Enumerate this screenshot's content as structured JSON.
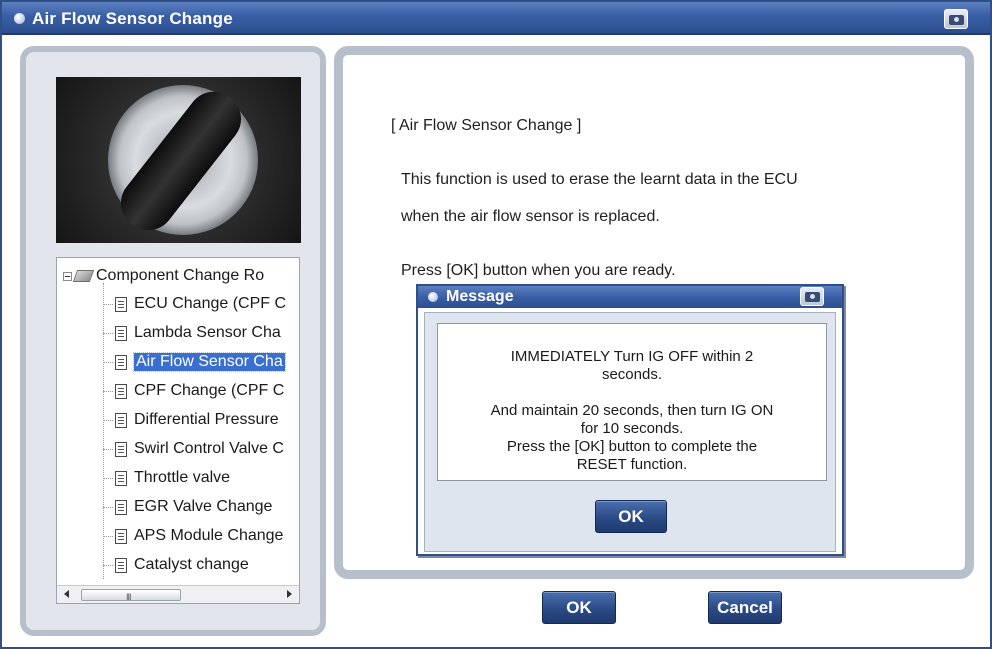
{
  "window": {
    "title": "Air Flow Sensor Change"
  },
  "tree": {
    "root_label": "Component Change Ro",
    "items": [
      {
        "label": "ECU Change (CPF C"
      },
      {
        "label": "Lambda Sensor Cha"
      },
      {
        "label": "Air Flow Sensor Cha",
        "selected": true
      },
      {
        "label": "CPF Change (CPF C"
      },
      {
        "label": "Differential Pressure"
      },
      {
        "label": "Swirl Control Valve C"
      },
      {
        "label": "Throttle valve"
      },
      {
        "label": "EGR Valve Change"
      },
      {
        "label": "APS Module Change"
      },
      {
        "label": "Catalyst change"
      }
    ],
    "scroll_grip": "III"
  },
  "main": {
    "heading": "[ Air Flow Sensor Change ]",
    "description_line1": "This function is used to erase the learnt data in the ECU",
    "description_line2": "when the air flow sensor is replaced.",
    "instruction": "Press [OK] button when you are ready."
  },
  "message": {
    "title": "Message",
    "lines": [
      "IMMEDIATELY Turn IG OFF within 2",
      "seconds.",
      "And maintain 20 seconds, then turn IG ON",
      "for 10 seconds.",
      "Press the [OK] button to complete the",
      "RESET function."
    ],
    "ok_label": "OK"
  },
  "footer": {
    "ok_label": "OK",
    "cancel_label": "Cancel"
  },
  "colors": {
    "titlebar": "#3a5fa6",
    "button": "#2b4b86",
    "selection": "#3a6fd0"
  }
}
